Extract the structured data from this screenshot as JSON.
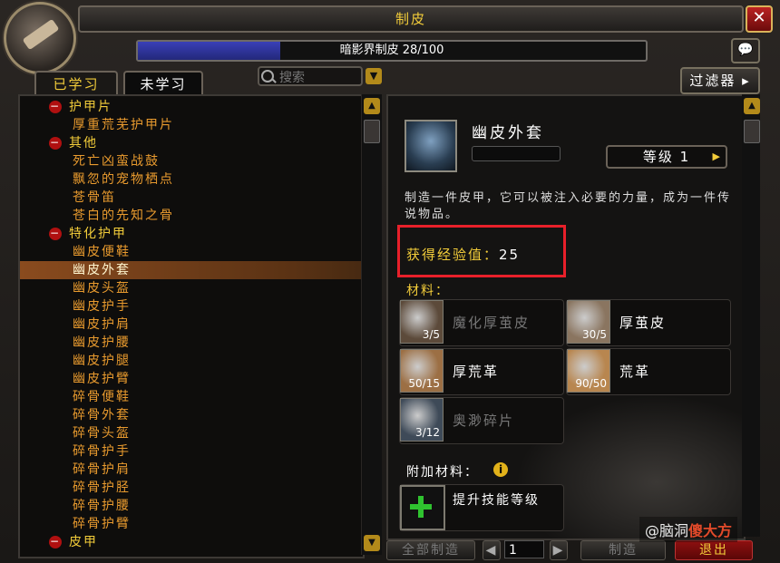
{
  "window": {
    "title": "制皮",
    "close_label": "✕"
  },
  "skill": {
    "label": "暗影界制皮 28/100",
    "progress": 0.28
  },
  "tabs": {
    "learned": "已学习",
    "unlearned": "未学习"
  },
  "search": {
    "placeholder": "搜索"
  },
  "filter_label": "过滤器",
  "recipe_list": [
    {
      "type": "category",
      "label": "护甲片"
    },
    {
      "type": "recipe",
      "label": "厚重荒芜护甲片"
    },
    {
      "type": "category",
      "label": "其他"
    },
    {
      "type": "recipe",
      "label": "死亡凶蛮战鼓"
    },
    {
      "type": "recipe",
      "label": "飘忽的宠物栖点"
    },
    {
      "type": "recipe",
      "label": "苍骨笛"
    },
    {
      "type": "recipe",
      "label": "苍白的先知之骨"
    },
    {
      "type": "category",
      "label": "特化护甲"
    },
    {
      "type": "recipe",
      "label": "幽皮便鞋"
    },
    {
      "type": "recipe",
      "label": "幽皮外套",
      "selected": true
    },
    {
      "type": "recipe",
      "label": "幽皮头盔"
    },
    {
      "type": "recipe",
      "label": "幽皮护手"
    },
    {
      "type": "recipe",
      "label": "幽皮护肩"
    },
    {
      "type": "recipe",
      "label": "幽皮护腰"
    },
    {
      "type": "recipe",
      "label": "幽皮护腿"
    },
    {
      "type": "recipe",
      "label": "幽皮护臂"
    },
    {
      "type": "recipe",
      "label": "碎骨便鞋"
    },
    {
      "type": "recipe",
      "label": "碎骨外套"
    },
    {
      "type": "recipe",
      "label": "碎骨头盔"
    },
    {
      "type": "recipe",
      "label": "碎骨护手"
    },
    {
      "type": "recipe",
      "label": "碎骨护肩"
    },
    {
      "type": "recipe",
      "label": "碎骨护胫"
    },
    {
      "type": "recipe",
      "label": "碎骨护腰"
    },
    {
      "type": "recipe",
      "label": "碎骨护臂"
    },
    {
      "type": "category",
      "label": "皮甲"
    }
  ],
  "detail": {
    "name": "幽皮外套",
    "level_label": "等级 1",
    "description": "制造一件皮甲，它可以被注入必要的力量，成为一件传说物品。",
    "xp_label": "获得经验值：",
    "xp_value": "25",
    "materials_label": "材料：",
    "materials": [
      {
        "name": "魔化厚茧皮",
        "count": "3/5",
        "have": false,
        "color": "#5c4a3a"
      },
      {
        "name": "厚茧皮",
        "count": "30/5",
        "have": true,
        "color": "#8a7560"
      },
      {
        "name": "厚荒革",
        "count": "50/15",
        "have": true,
        "color": "#9c6f44"
      },
      {
        "name": "荒革",
        "count": "90/50",
        "have": true,
        "color": "#b8864f"
      },
      {
        "name": "奥渺碎片",
        "count": "3/12",
        "have": false,
        "color": "#3e4a58"
      }
    ],
    "extra_label": "附加材料：",
    "extra_item": "提升技能等级"
  },
  "bottom": {
    "craft_all": "全部制造",
    "quantity": "1",
    "craft": "制造",
    "exit": "退出"
  },
  "watermark": {
    "prefix": "@脑洞",
    "brand": "傻大方"
  }
}
